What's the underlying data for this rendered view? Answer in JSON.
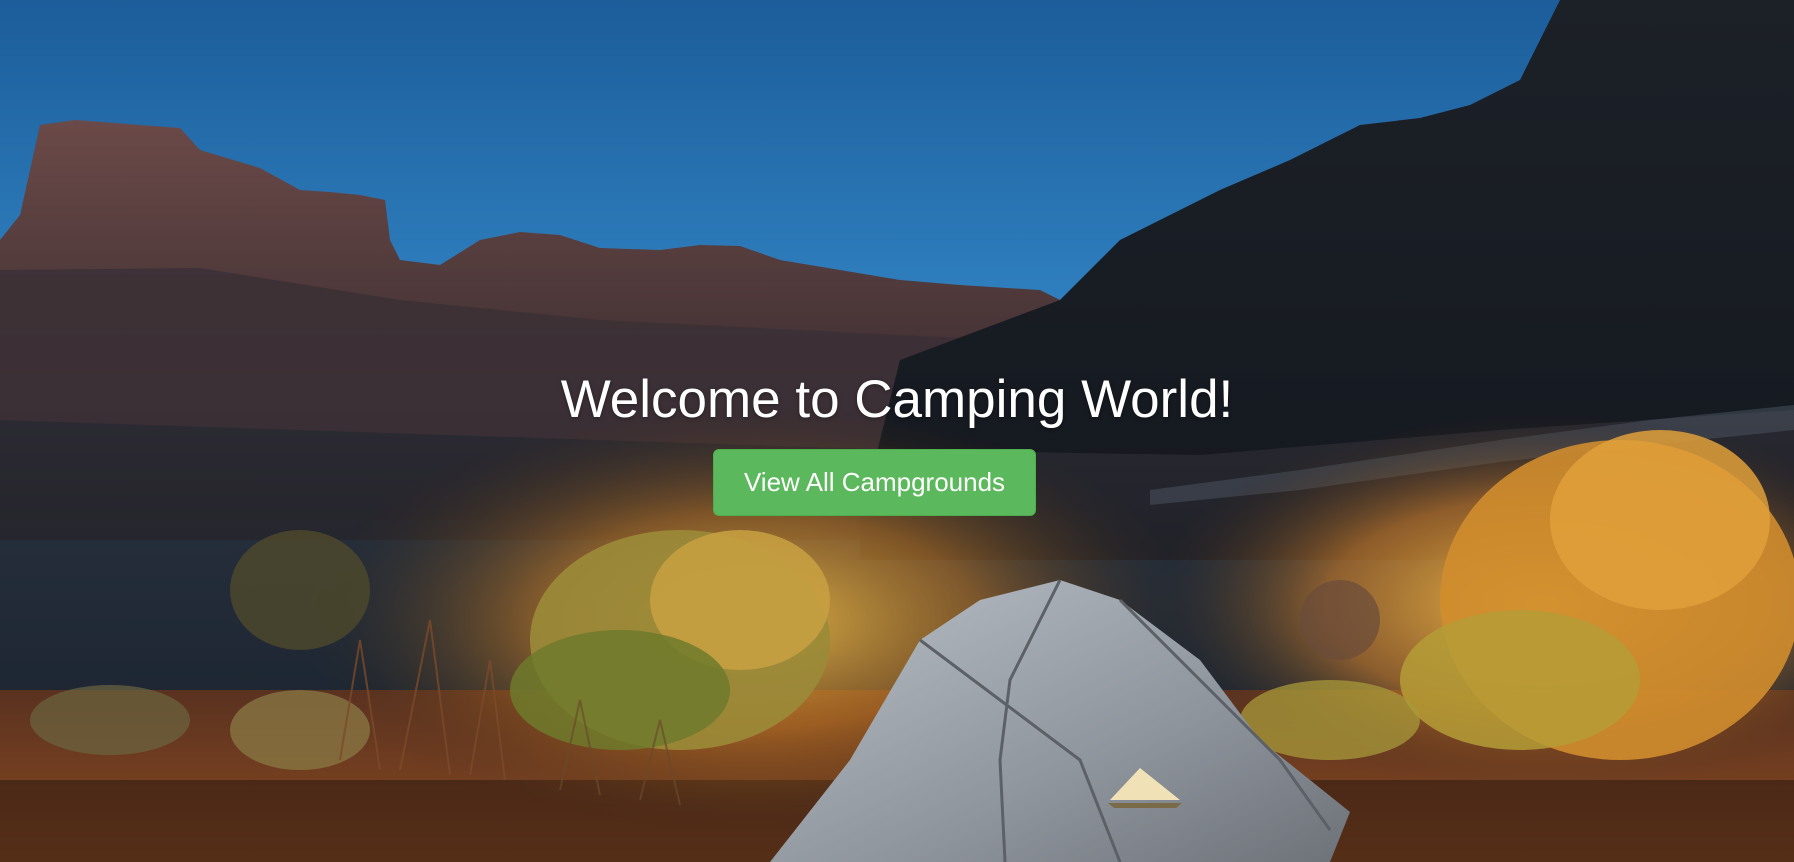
{
  "hero": {
    "title": "Welcome to Camping World!",
    "button_label": "View All Campgrounds",
    "button_color": "#5cb85c",
    "background_image": "night desert canyon with a lit tent"
  }
}
